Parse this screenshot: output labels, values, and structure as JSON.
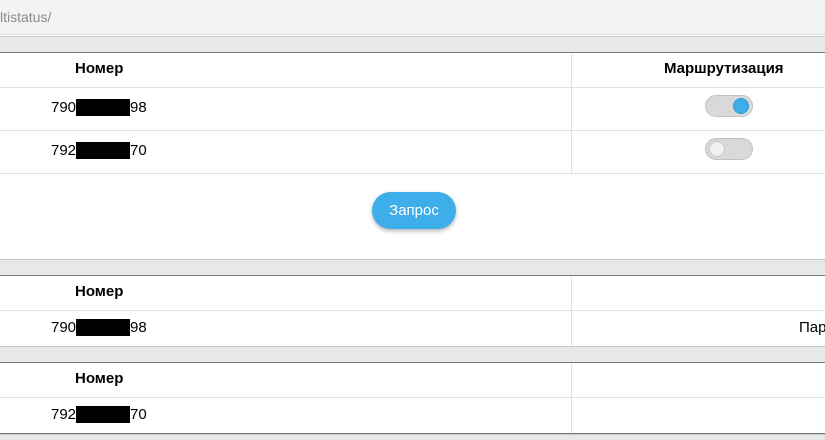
{
  "address_bar": {
    "url_fragment": "ltistatus/"
  },
  "routing_table": {
    "col_number": "Номер",
    "col_routing": "Маршрутизация",
    "rows": [
      {
        "prefix": "790",
        "suffix": "98",
        "routing_enabled": true
      },
      {
        "prefix": "792",
        "suffix": "70",
        "routing_enabled": false
      }
    ]
  },
  "request_button": {
    "label": "Запрос"
  },
  "result_table_1": {
    "col_number": "Номер",
    "row": {
      "prefix": "790",
      "suffix": "98",
      "value_cut": "Пар"
    }
  },
  "result_table_2": {
    "col_number": "Номер",
    "row": {
      "prefix": "792",
      "suffix": "70"
    }
  }
}
